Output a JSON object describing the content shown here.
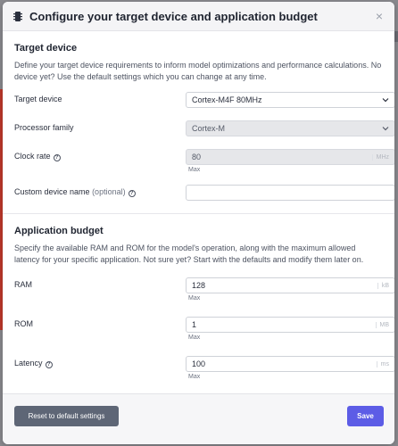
{
  "modal": {
    "title": "Configure your target device and application budget",
    "icon": "chip-icon"
  },
  "target_device": {
    "title": "Target device",
    "description": "Define your target device requirements to inform model optimizations and performance calculations. No device yet? Use the default settings which you can change at any time.",
    "device_label": "Target device",
    "device_value": "Cortex-M4F 80MHz",
    "family_label": "Processor family",
    "family_value": "Cortex-M",
    "clock_label": "Clock rate",
    "clock_value": "80",
    "clock_unit": "MHz",
    "clock_hint": "Max",
    "custom_name_label": "Custom device name",
    "custom_name_optional": "(optional)",
    "custom_name_value": ""
  },
  "budget": {
    "title": "Application budget",
    "description": "Specify the available RAM and ROM for the model's operation, along with the maximum allowed latency for your specific application. Not sure yet? Start with the defaults and modify them later on.",
    "ram_label": "RAM",
    "ram_value": "128",
    "ram_unit": "kB",
    "ram_hint": "Max",
    "rom_label": "ROM",
    "rom_value": "1",
    "rom_unit": "MB",
    "rom_hint": "Max",
    "latency_label": "Latency",
    "latency_value": "100",
    "latency_unit": "ms",
    "latency_hint": "Max"
  },
  "footer": {
    "reset_label": "Reset to default settings",
    "save_label": "Save"
  },
  "colors": {
    "save_button": "#5c5ce6",
    "reset_button": "#5e6676",
    "disabled_field": "#e6e7ea"
  }
}
